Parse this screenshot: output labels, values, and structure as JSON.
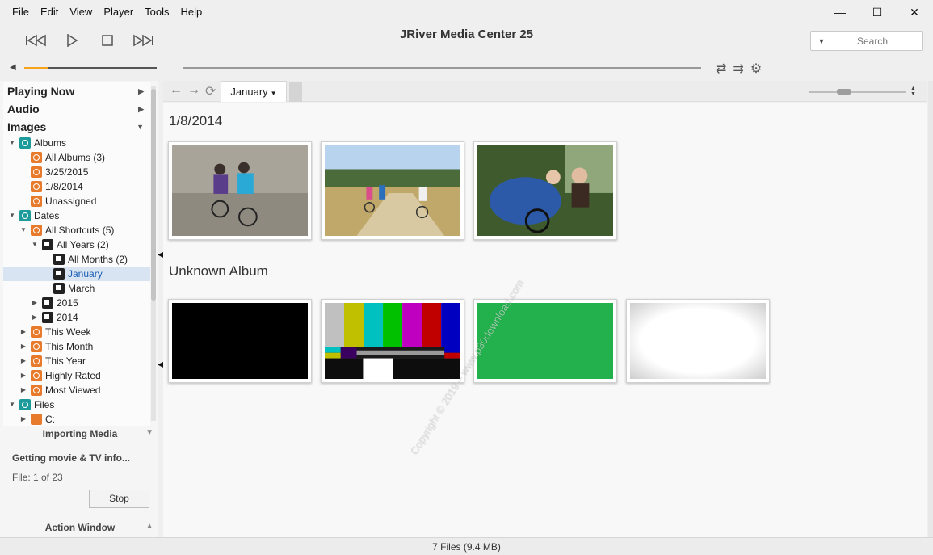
{
  "menu": [
    "File",
    "Edit",
    "View",
    "Player",
    "Tools",
    "Help"
  ],
  "window": {
    "title": "JRiver Media Center 25",
    "minimize": "—",
    "maximize": "☐",
    "close": "✕"
  },
  "search": {
    "placeholder": "Search"
  },
  "player": {
    "volume_fraction": 0.18,
    "position_fraction": 0.0
  },
  "sidebar": {
    "sections": [
      {
        "label": "Playing Now",
        "arrow": "▶"
      },
      {
        "label": "Audio",
        "arrow": "▶"
      },
      {
        "label": "Images",
        "arrow": "▼"
      }
    ],
    "tree": [
      {
        "label": "Albums",
        "icon": "teal",
        "toggle": "▼",
        "level": 1
      },
      {
        "label": "All Albums (3)",
        "icon": "album",
        "toggle": "",
        "level": 2
      },
      {
        "label": "3/25/2015",
        "icon": "album",
        "toggle": "",
        "level": 2
      },
      {
        "label": "1/8/2014",
        "icon": "album",
        "toggle": "",
        "level": 2
      },
      {
        "label": "Unassigned",
        "icon": "album",
        "toggle": "",
        "level": 2
      },
      {
        "label": "Dates",
        "icon": "teal",
        "toggle": "▼",
        "level": 1
      },
      {
        "label": "All Shortcuts (5)",
        "icon": "album",
        "toggle": "▼",
        "level": 2
      },
      {
        "label": "All Years (2)",
        "icon": "cal",
        "toggle": "▼",
        "level": 3
      },
      {
        "label": "All Months (2)",
        "icon": "cal",
        "toggle": "",
        "level": 4
      },
      {
        "label": "January",
        "icon": "cal",
        "toggle": "",
        "level": 4,
        "selected": true
      },
      {
        "label": "March",
        "icon": "cal",
        "toggle": "",
        "level": 4
      },
      {
        "label": "2015",
        "icon": "cal",
        "toggle": "▶",
        "level": 3
      },
      {
        "label": "2014",
        "icon": "cal",
        "toggle": "▶",
        "level": 3
      },
      {
        "label": "This Week",
        "icon": "album",
        "toggle": "▶",
        "level": 2
      },
      {
        "label": "This Month",
        "icon": "album",
        "toggle": "▶",
        "level": 2
      },
      {
        "label": "This Year",
        "icon": "album",
        "toggle": "▶",
        "level": 2
      },
      {
        "label": "Highly Rated",
        "icon": "album",
        "toggle": "▶",
        "level": 2
      },
      {
        "label": "Most Viewed",
        "icon": "album",
        "toggle": "▶",
        "level": 2
      },
      {
        "label": "Files",
        "icon": "teal",
        "toggle": "▼",
        "level": 1
      },
      {
        "label": "C:",
        "icon": "drive",
        "toggle": "▶",
        "level": 2
      }
    ],
    "importing": {
      "title": "Importing Media",
      "status": "Getting movie & TV info...",
      "file_progress": "File: 1 of 23",
      "stop_label": "Stop"
    },
    "action_window": {
      "title": "Action Window"
    }
  },
  "tab": {
    "label": "January"
  },
  "groups": [
    {
      "title": "1/8/2014",
      "thumbs": [
        "bmx-riders",
        "bike-trail-group",
        "cyclists-closeup"
      ]
    },
    {
      "title": "Unknown Album",
      "thumbs": [
        "black-frame",
        "color-bars",
        "green-frame",
        "white-vignette"
      ]
    }
  ],
  "status": {
    "text": "7 Files (9.4 MB)"
  },
  "colors": {
    "accent": "#f7a21b",
    "selection": "#d8e4f2",
    "teal_icon": "#1d9b9b",
    "album_icon": "#e87a2b"
  },
  "watermark": "Copyright © 2019 – www.p30download.com"
}
